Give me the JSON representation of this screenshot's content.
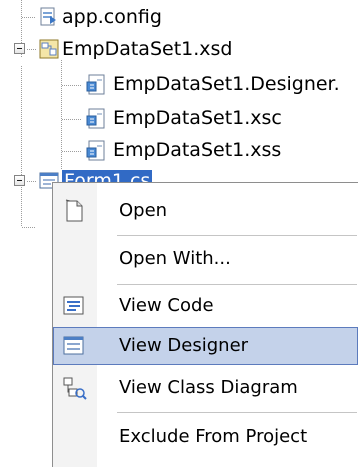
{
  "tree": {
    "items": [
      {
        "label": "app.config",
        "icon": "config-file-icon"
      },
      {
        "label": "EmpDataSet1.xsd",
        "icon": "dataset-file-icon",
        "expanded": true
      },
      {
        "label": "EmpDataSet1.Designer.",
        "icon": "cs-file-icon"
      },
      {
        "label": "EmpDataSet1.xsc",
        "icon": "cs-file-icon"
      },
      {
        "label": "EmpDataSet1.xss",
        "icon": "cs-file-icon"
      },
      {
        "label": "Form1.cs",
        "icon": "form-file-icon",
        "expanded": true,
        "selected": true
      }
    ]
  },
  "context_menu": {
    "items": [
      {
        "label": "Open",
        "icon": "open-document-icon"
      },
      {
        "label": "Open With...",
        "icon": ""
      },
      {
        "label": "View Code",
        "icon": "view-code-icon"
      },
      {
        "label": "View Designer",
        "icon": "view-designer-icon",
        "highlighted": true
      },
      {
        "label": "View Class Diagram",
        "icon": "class-diagram-icon"
      },
      {
        "label": "Exclude From Project",
        "icon": ""
      }
    ]
  },
  "colors": {
    "selection": "#316ac5",
    "menu_highlight": "#c4d2ea",
    "menu_highlight_border": "#5c7bbd",
    "menu_gutter": "#f3f3f3"
  }
}
